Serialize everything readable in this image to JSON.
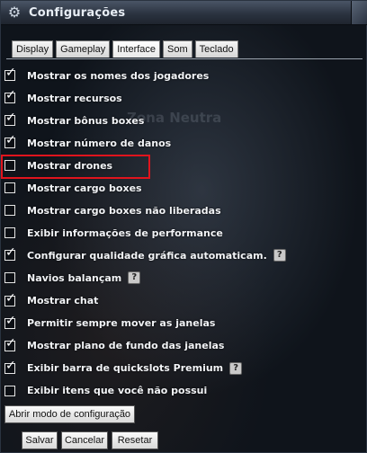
{
  "window": {
    "title": "Configurações",
    "icon": "gear-icon"
  },
  "tabs": [
    {
      "label": "Display",
      "active": false
    },
    {
      "label": "Gameplay",
      "active": false
    },
    {
      "label": "Interface",
      "active": true
    },
    {
      "label": "Som",
      "active": false
    },
    {
      "label": "Teclado",
      "active": false
    }
  ],
  "background_text": {
    "zone": "Zona Neutra"
  },
  "options": [
    {
      "label": "Mostrar os nomes dos jogadores",
      "checked": true,
      "help": false
    },
    {
      "label": "Mostrar recursos",
      "checked": true,
      "help": false
    },
    {
      "label": "Mostrar bônus boxes",
      "checked": true,
      "help": false
    },
    {
      "label": "Mostrar número de danos",
      "checked": true,
      "help": false
    },
    {
      "label": "Mostrar drones",
      "checked": false,
      "help": false,
      "highlighted": true
    },
    {
      "label": "Mostrar cargo boxes",
      "checked": false,
      "help": false
    },
    {
      "label": "Mostrar cargo boxes não liberadas",
      "checked": false,
      "help": false
    },
    {
      "label": "Exibir informações de performance",
      "checked": false,
      "help": false
    },
    {
      "label": "Configurar qualidade gráfica automaticam.",
      "checked": true,
      "help": true
    },
    {
      "label": "Navios balançam",
      "checked": false,
      "help": true
    },
    {
      "label": "Mostrar chat",
      "checked": true,
      "help": false
    },
    {
      "label": "Permitir sempre mover as janelas",
      "checked": true,
      "help": false
    },
    {
      "label": "Mostrar plano de fundo das janelas",
      "checked": true,
      "help": false
    },
    {
      "label": "Exibir barra de quickslots Premium",
      "checked": true,
      "help": true
    },
    {
      "label": "Exibir itens que você não possui",
      "checked": false,
      "help": false
    }
  ],
  "help_glyph": "?",
  "buttons": {
    "config_mode": "Abrir modo de configuração",
    "save": "Salvar",
    "cancel": "Cancelar",
    "reset": "Resetar"
  },
  "colors": {
    "highlight": "#e0141d"
  }
}
